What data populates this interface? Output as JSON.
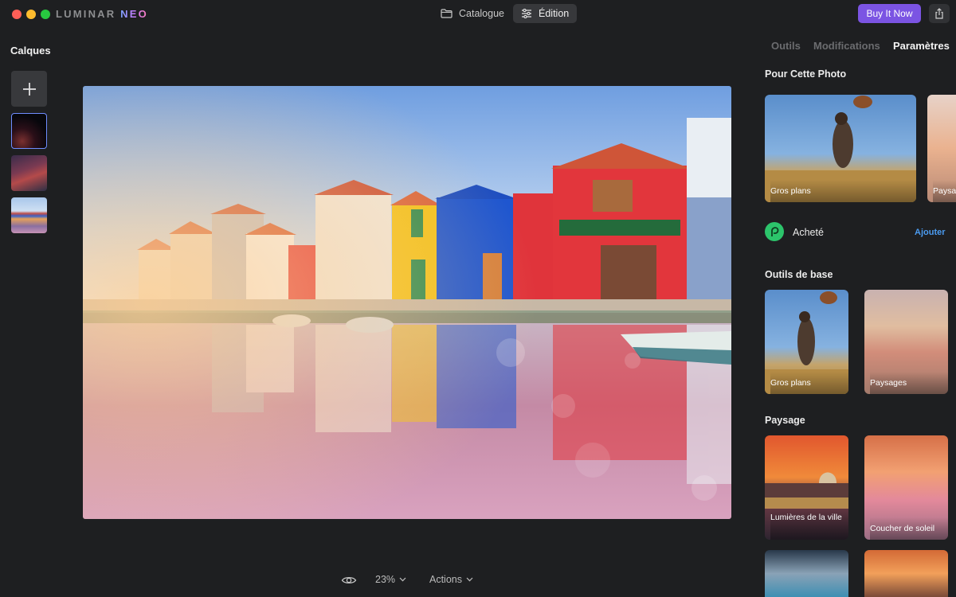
{
  "app": {
    "logo_main": "LUMINAR ",
    "logo_accent": "NEO"
  },
  "titlebar": {
    "catalogue_label": "Catalogue",
    "edition_label": "Édition",
    "buy_label": "Buy It Now"
  },
  "layers": {
    "title": "Calques"
  },
  "bottom_bar": {
    "zoom_label": "23%",
    "actions_label": "Actions"
  },
  "right_panel": {
    "tabs": [
      {
        "label": "Outils",
        "active": false
      },
      {
        "label": "Modifications",
        "active": false
      },
      {
        "label": "Paramètres",
        "active": true
      }
    ],
    "sections": {
      "for_photo": {
        "title": "Pour Cette Photo",
        "cards": [
          {
            "label": "Gros plans"
          },
          {
            "label": "Paysa"
          }
        ]
      },
      "purchased": {
        "label": "Acheté",
        "add_label": "Ajouter"
      },
      "basic": {
        "title": "Outils de base",
        "cards": [
          {
            "label": "Gros plans"
          },
          {
            "label": "Paysages"
          }
        ]
      },
      "landscape": {
        "title": "Paysage",
        "cards": [
          {
            "label": "Lumières de la ville"
          },
          {
            "label": "Coucher de soleil"
          }
        ]
      }
    }
  },
  "colors": {
    "accent_purple": "#7b54e3",
    "link_blue": "#4b9bf0",
    "purchased_green": "#2cc46b"
  }
}
